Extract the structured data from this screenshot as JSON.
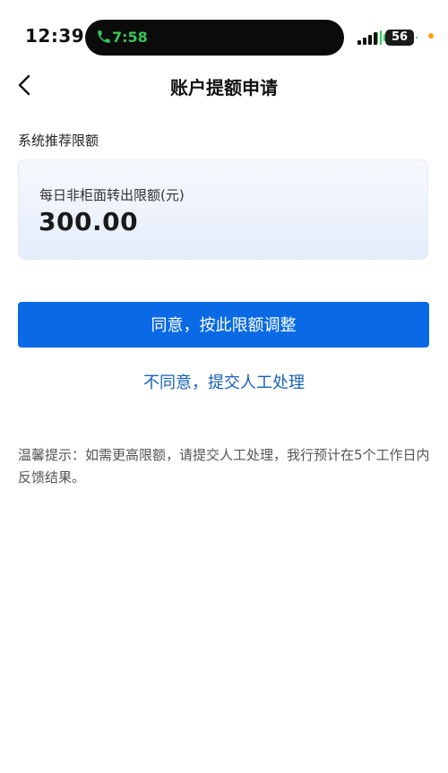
{
  "status_bar": {
    "time": "12:39",
    "call_time": "7:58",
    "battery": "56"
  },
  "nav": {
    "title": "账户提额申请"
  },
  "section": {
    "label": "系统推荐限额"
  },
  "limit_card": {
    "label": "每日非柜面转出限额(元)",
    "value": "300.00"
  },
  "actions": {
    "agree_label": "同意，按此限额调整",
    "disagree_label": "不同意，提交人工处理"
  },
  "tip": {
    "text": "温馨提示：如需更高限额，请提交人工处理，我行预计在5个工作日内反馈结果。"
  },
  "colors": {
    "primary_button": "#0a6ae6",
    "link": "#1a61b8",
    "call_green": "#35c759"
  },
  "icons": {
    "back": "chevron-left-icon",
    "call": "phone-icon",
    "waveform": "audio-waveform-icon",
    "signal": "signal-bars-icon"
  }
}
